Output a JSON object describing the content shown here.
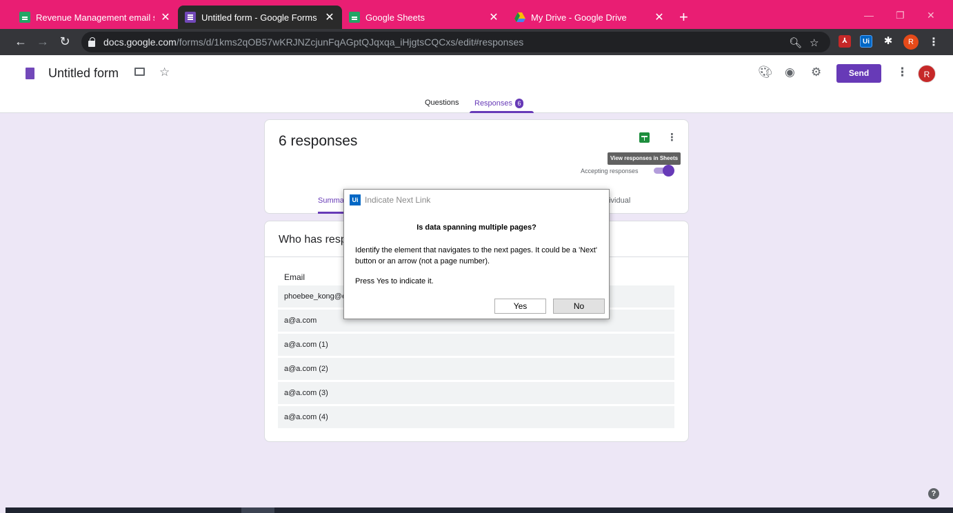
{
  "browser": {
    "tabs": [
      {
        "title": "Revenue Management email sub",
        "icon": "sheets-icon"
      },
      {
        "title": "Untitled form - Google Forms",
        "icon": "forms-icon"
      },
      {
        "title": "Google Sheets",
        "icon": "sheets-icon"
      },
      {
        "title": "My Drive - Google Drive",
        "icon": "drive-icon"
      }
    ],
    "active_tab": 1,
    "url_domain": "docs.google.com",
    "url_path": "/forms/d/1kms2qOB57wKRJNZcjunFqAGptQJqxqa_iHjgtsCQCxs/edit#responses",
    "profile_initial": "R"
  },
  "form": {
    "title": "Untitled form",
    "send_label": "Send",
    "avatar_initial": "R",
    "tabs": {
      "questions": "Questions",
      "responses": "Responses",
      "responses_count": "6"
    }
  },
  "summary_card": {
    "count_label": "6 responses",
    "tooltip": "View responses in Sheets",
    "accepting_label": "Accepting responses",
    "accepting": true,
    "subtab_summary": "Summa",
    "subtab_individual": "dividual"
  },
  "responders_card": {
    "title": "Who has resp",
    "column_header": "Email",
    "emails": [
      "phoebee_kong@e",
      "a@a.com",
      "a@a.com (1)",
      "a@a.com (2)",
      "a@a.com (3)",
      "a@a.com (4)"
    ]
  },
  "dialog": {
    "app_logo": "Ui",
    "title": "Indicate Next Link",
    "heading": "Is data spanning multiple pages?",
    "body": "Identify the element that navigates to the next pages. It could be a 'Next' button or an arrow (not a page number).",
    "press_text": "Press Yes to indicate it.",
    "yes_label": "Yes",
    "no_label": "No"
  },
  "colors": {
    "tabstrip": "#e91e73",
    "forms_accent": "#673ab7",
    "page_background": "#ede7f6"
  }
}
